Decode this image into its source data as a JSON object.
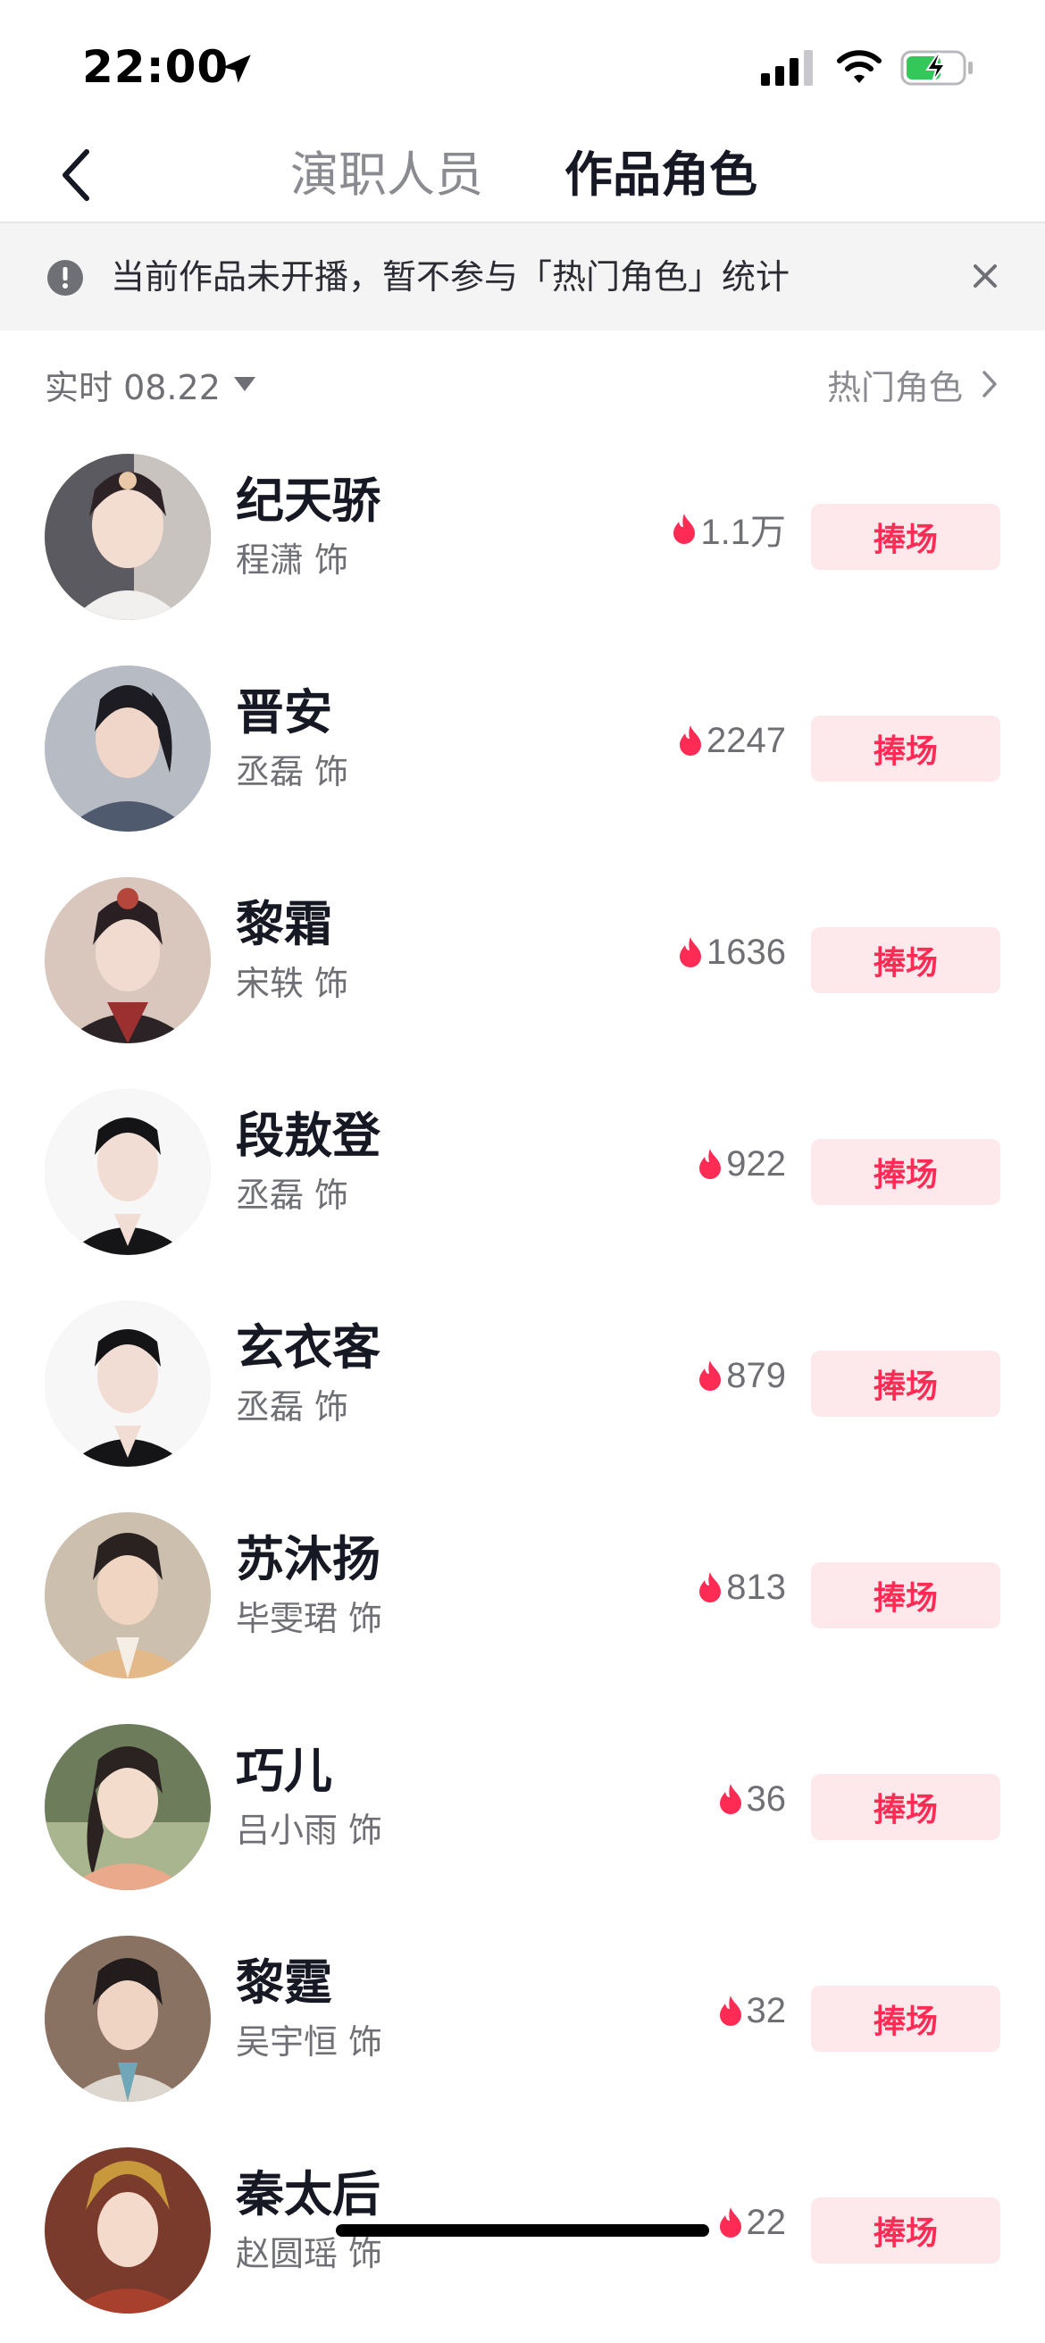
{
  "status_bar": {
    "time": "22:00"
  },
  "header": {
    "tabs": [
      {
        "label": "演职人员",
        "active": false
      },
      {
        "label": "作品角色",
        "active": true
      }
    ]
  },
  "notice": {
    "text": "当前作品未开播，暂不参与「热门角色」统计"
  },
  "filter": {
    "date_label": "实时 08.22",
    "hot_roles_label": "热门角色"
  },
  "roles": [
    {
      "name": "纪天骄",
      "actor": "程潇",
      "role_suffix": "饰",
      "heat": "1.1万",
      "button": "捧场"
    },
    {
      "name": "晋安",
      "actor": "丞磊",
      "role_suffix": "饰",
      "heat": "2247",
      "button": "捧场"
    },
    {
      "name": "黎霜",
      "actor": "宋轶",
      "role_suffix": "饰",
      "heat": "1636",
      "button": "捧场"
    },
    {
      "name": "段敖登",
      "actor": "丞磊",
      "role_suffix": "饰",
      "heat": "922",
      "button": "捧场"
    },
    {
      "name": "玄衣客",
      "actor": "丞磊",
      "role_suffix": "饰",
      "heat": "879",
      "button": "捧场"
    },
    {
      "name": "苏沐扬",
      "actor": "毕雯珺",
      "role_suffix": "饰",
      "heat": "813",
      "button": "捧场"
    },
    {
      "name": "巧儿",
      "actor": "吕小雨",
      "role_suffix": "饰",
      "heat": "36",
      "button": "捧场"
    },
    {
      "name": "黎霆",
      "actor": "吴宇恒",
      "role_suffix": "饰",
      "heat": "32",
      "button": "捧场"
    },
    {
      "name": "秦太后",
      "actor": "赵圆瑶",
      "role_suffix": "饰",
      "heat": "22",
      "button": "捧场"
    }
  ],
  "colors": {
    "accent": "#fe2c55",
    "button_bg": "#fde8ec",
    "banner_bg": "#f4f4f5",
    "flame": "#fe2c55"
  }
}
